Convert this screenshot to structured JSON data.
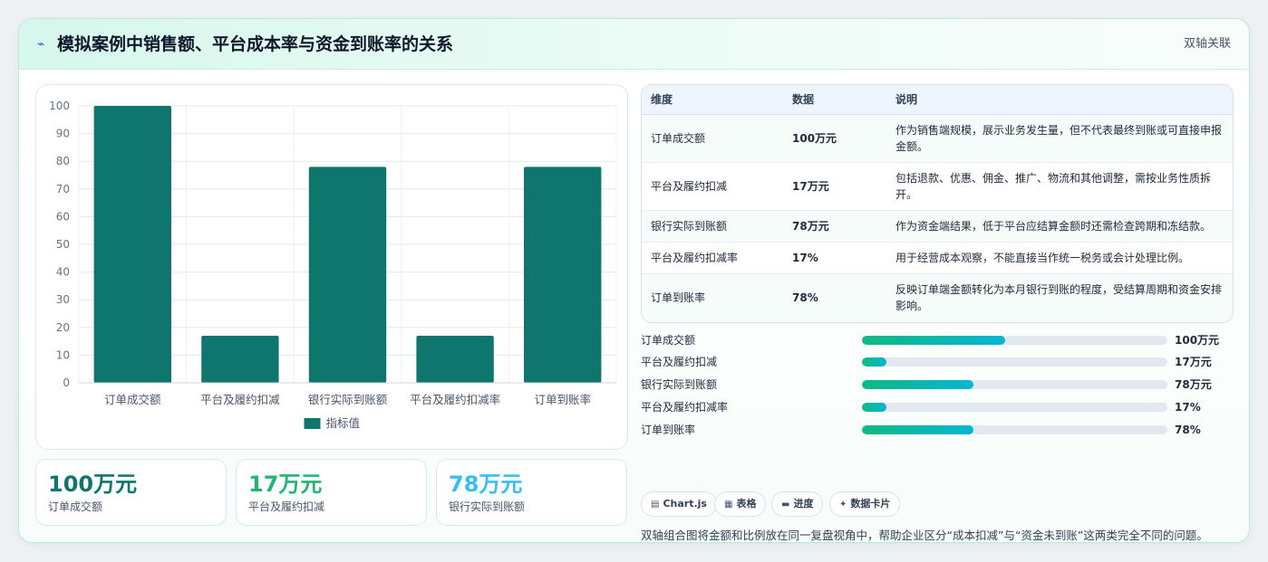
{
  "header": {
    "title": "模拟案例中销售额、平台成本率与资金到账率的关系",
    "tag": "双轴关联",
    "title_icon": "lightning-icon"
  },
  "colors": {
    "bar": "#0f766e",
    "accent_green": "#10b981",
    "accent_cyan": "#06b6d4",
    "stat_1": "#0f766e",
    "stat_2": "#22b573",
    "stat_3": "#38bdf8"
  },
  "chart_data": {
    "type": "bar",
    "categories": [
      "订单成交额",
      "平台及履约扣减",
      "银行实际到账额",
      "平台及履约扣减率",
      "订单到账率"
    ],
    "series": [
      {
        "name": "指标值",
        "values": [
          100,
          17,
          78,
          17,
          78
        ]
      }
    ],
    "yticks": [
      "0",
      "10",
      "20",
      "30",
      "40",
      "50",
      "60",
      "70",
      "80",
      "90",
      "100"
    ],
    "ylim": [
      0,
      100
    ],
    "grid": true,
    "legend": "bottom"
  },
  "stats": [
    {
      "value": "100万元",
      "label": "订单成交额"
    },
    {
      "value": "17万元",
      "label": "平台及履约扣减"
    },
    {
      "value": "78万元",
      "label": "银行实际到账额"
    }
  ],
  "table": {
    "headers": [
      "维度",
      "数据",
      "说明"
    ],
    "rows": [
      {
        "dim": "订单成交额",
        "data": "100万元",
        "desc": "作为销售端规模，展示业务发生量，但不代表最终到账或可直接申报金额。"
      },
      {
        "dim": "平台及履约扣减",
        "data": "17万元",
        "desc": "包括退款、优惠、佣金、推广、物流和其他调整，需按业务性质拆开。"
      },
      {
        "dim": "银行实际到账额",
        "data": "78万元",
        "desc": "作为资金端结果，低于平台应结算金额时还需检查跨期和冻结款。"
      },
      {
        "dim": "平台及履约扣减率",
        "data": "17%",
        "desc": "用于经营成本观察，不能直接当作统一税务或会计处理比例。"
      },
      {
        "dim": "订单到账率",
        "data": "78%",
        "desc": "反映订单端金额转化为本月银行到账的程度，受结算周期和资金安排影响。"
      }
    ]
  },
  "progress": [
    {
      "label": "订单成交额",
      "value": "100万元",
      "ratio": 0.47
    },
    {
      "label": "平台及履约扣减",
      "value": "17万元",
      "ratio": 0.08
    },
    {
      "label": "银行实际到账额",
      "value": "78万元",
      "ratio": 0.365
    },
    {
      "label": "平台及履约扣减率",
      "value": "17%",
      "ratio": 0.08
    },
    {
      "label": "订单到账率",
      "value": "78%",
      "ratio": 0.365
    }
  ],
  "badges": [
    {
      "icon": "chart-icon",
      "glyph": "▤",
      "label": "Chart.js"
    },
    {
      "icon": "table-icon",
      "glyph": "▦",
      "label": "表格"
    },
    {
      "icon": "progress-icon",
      "glyph": "▬",
      "label": "进度"
    },
    {
      "icon": "card-icon",
      "glyph": "✦",
      "label": "数据卡片"
    }
  ],
  "note": "双轴组合图将金额和比例放在同一复盘视角中，帮助企业区分“成本扣减”与“资金未到账”这两类完全不同的问题。"
}
